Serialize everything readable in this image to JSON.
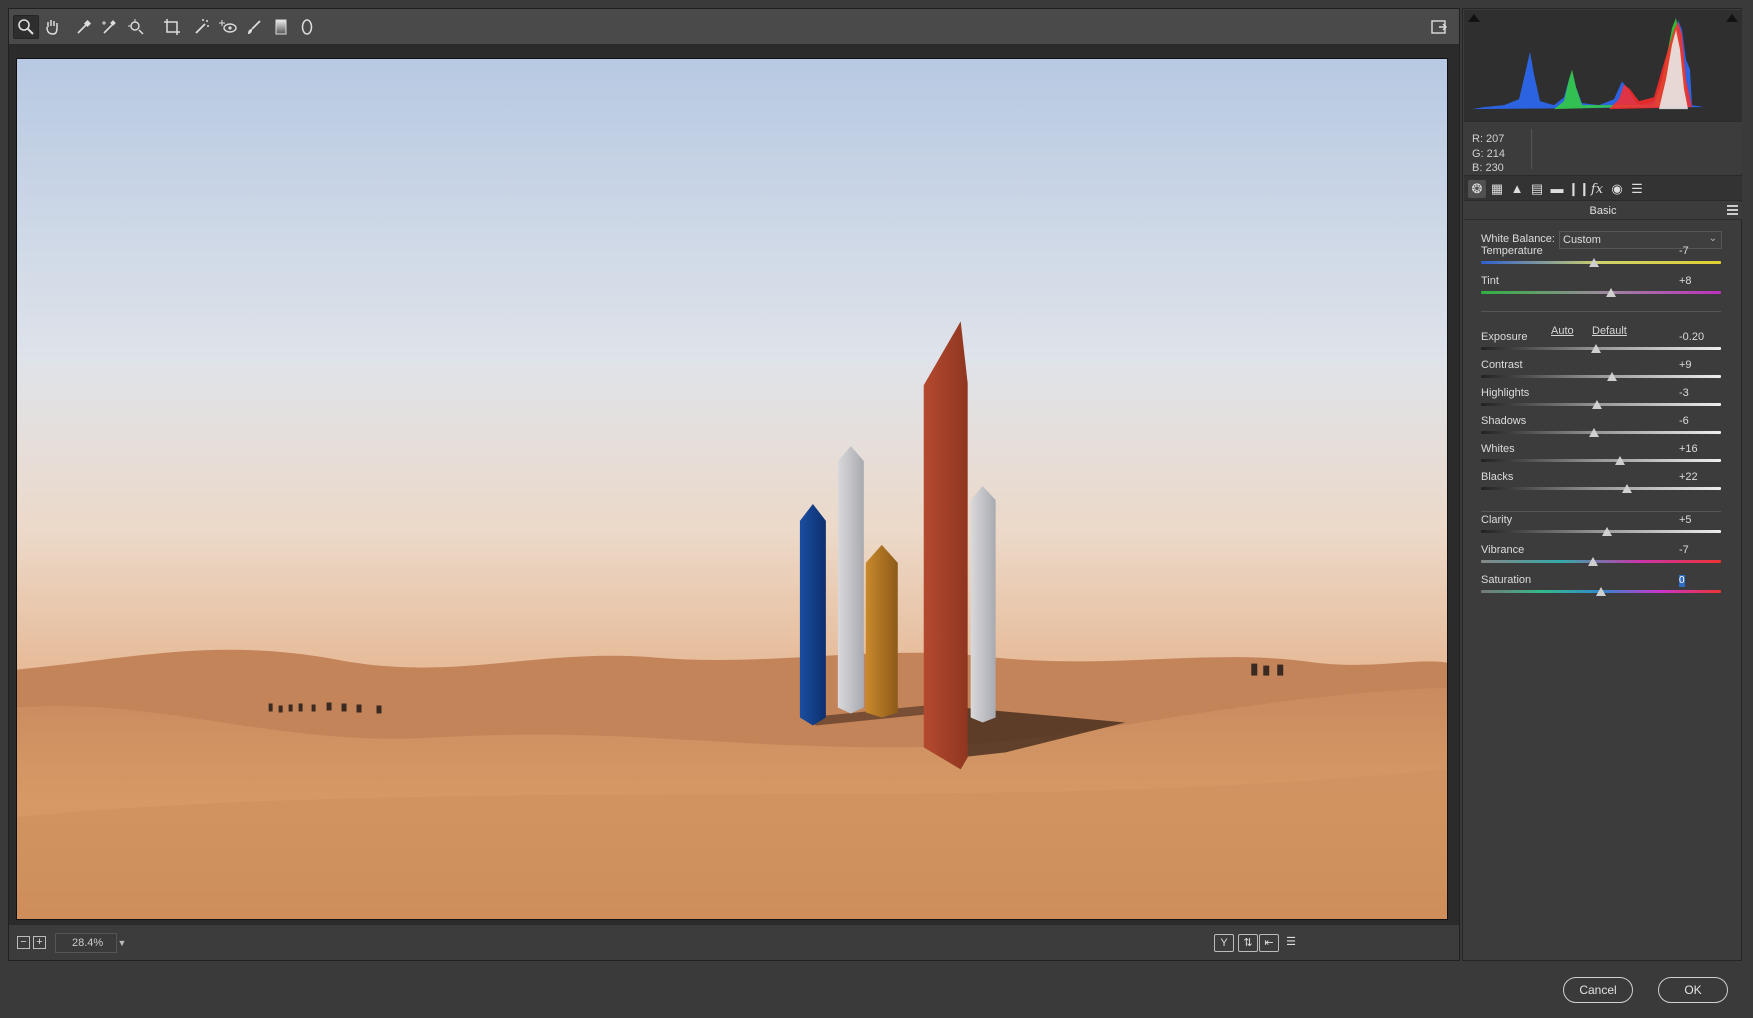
{
  "toolbar": {
    "tools": [
      {
        "name": "zoom-tool",
        "icon": "zoom-icon"
      },
      {
        "name": "hand-tool",
        "icon": "hand-icon"
      },
      {
        "name": "white-balance-tool",
        "icon": "eyedropper-icon"
      },
      {
        "name": "color-sampler-tool",
        "icon": "color-sampler-icon"
      },
      {
        "name": "targeted-adjustment-tool",
        "icon": "target-icon"
      },
      {
        "name": "crop-tool",
        "icon": "crop-icon"
      },
      {
        "name": "spot-removal-tool",
        "icon": "spot-removal-icon"
      },
      {
        "name": "red-eye-tool",
        "icon": "red-eye-icon"
      },
      {
        "name": "adjustment-brush-tool",
        "icon": "brush-icon"
      },
      {
        "name": "graduated-filter-tool",
        "icon": "graduated-filter-icon"
      },
      {
        "name": "radial-filter-tool",
        "icon": "radial-filter-icon"
      }
    ],
    "fullscreen_icon": "fullscreen-icon"
  },
  "zoom": {
    "value": "28.4%"
  },
  "readout": {
    "r": "R:  207",
    "g": "G:  214",
    "b": "B:  230"
  },
  "panel": {
    "title": "Basic",
    "white_balance": {
      "label": "White Balance:",
      "value": "Custom"
    },
    "auto_label": "Auto",
    "default_label": "Default",
    "sliders": [
      {
        "key": "temperature",
        "label": "Temperature",
        "value": "-7",
        "pos": 0.47
      },
      {
        "key": "tint",
        "label": "Tint",
        "value": "+8",
        "pos": 0.54
      },
      {
        "key": "exposure",
        "label": "Exposure",
        "value": "-0.20",
        "pos": 0.48
      },
      {
        "key": "contrast",
        "label": "Contrast",
        "value": "+9",
        "pos": 0.545
      },
      {
        "key": "highlights",
        "label": "Highlights",
        "value": "-3",
        "pos": 0.485
      },
      {
        "key": "shadows",
        "label": "Shadows",
        "value": "-6",
        "pos": 0.47
      },
      {
        "key": "whites",
        "label": "Whites",
        "value": "+16",
        "pos": 0.58
      },
      {
        "key": "blacks",
        "label": "Blacks",
        "value": "+22",
        "pos": 0.61
      },
      {
        "key": "clarity",
        "label": "Clarity",
        "value": "+5",
        "pos": 0.525
      },
      {
        "key": "vibrance",
        "label": "Vibrance",
        "value": "-7",
        "pos": 0.465
      },
      {
        "key": "saturation",
        "label": "Saturation",
        "value": "0",
        "pos": 0.5
      }
    ]
  },
  "buttons": {
    "cancel": "Cancel",
    "ok": "OK"
  }
}
